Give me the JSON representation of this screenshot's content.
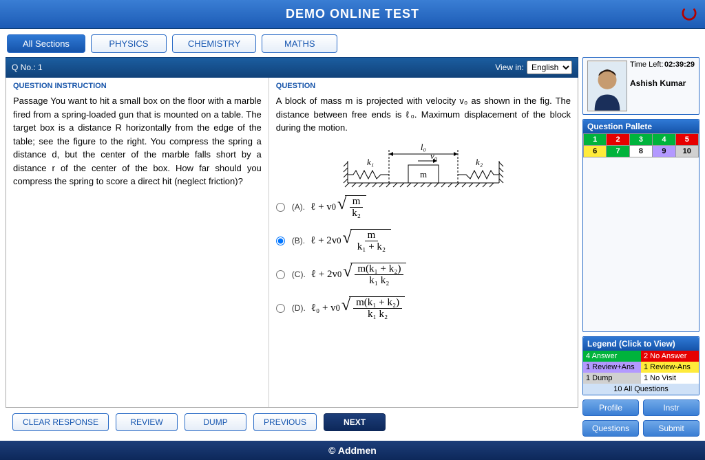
{
  "header": {
    "title": "DEMO ONLINE TEST"
  },
  "tabs": [
    {
      "label": "All Sections",
      "active": true
    },
    {
      "label": "PHYSICS"
    },
    {
      "label": "CHEMISTRY"
    },
    {
      "label": "MATHS"
    }
  ],
  "qbar": {
    "qno": "Q No.: 1",
    "viewin": "View in:",
    "lang": "English"
  },
  "labels": {
    "instruction": "QUESTION INSTRUCTION",
    "question": "QUESTION"
  },
  "passage": "Passage You want to hit a small box on the floor with a marble fired from a spring-loaded gun that is mounted on a table. The target box is a distance R horizontally from the edge of the table; see the figure to the right. You compress the spring a distance d, but the center of the marble falls short by a distance r of the center of the box. How far should you compress the spring to score a direct hit (neglect friction)?",
  "question": "A block of mass m is projected with velocity v₀ as shown in the fig. The distance between free ends is ℓ₀. Maximum displacement of the block during the motion.",
  "options": {
    "A": "(A).",
    "B": "(B).",
    "C": "(C).",
    "D": "(D)."
  },
  "formula": {
    "A": {
      "prefix": "ℓ + v",
      "sub": "0",
      "num": "m",
      "den": "k₂"
    },
    "B": {
      "prefix": "ℓ + 2v",
      "sub": "0",
      "num": "m",
      "den": "k₁ + k₂"
    },
    "C": {
      "prefix": "ℓ + 2v",
      "sub": "0",
      "num": "m(k₁ + k₂)",
      "den": "k₁ k₂"
    },
    "D": {
      "prefix": "ℓ₀ + v",
      "sub": "0",
      "num": "m(k₁ + k₂)",
      "den": "k₁ k₂"
    }
  },
  "diagram": {
    "l0": "l₀",
    "k1": "k₁",
    "k2": "k₂",
    "m": "m",
    "v0": "v₀"
  },
  "buttons": {
    "clear": "CLEAR RESPONSE",
    "review": "REVIEW",
    "dump": "DUMP",
    "prev": "PREVIOUS",
    "next": "NEXT"
  },
  "footer": "© Addmen",
  "user": {
    "timelabel": "Time Left:",
    "time": "02:39:29",
    "name": "Ashish Kumar"
  },
  "palette": {
    "title": "Question Pallete",
    "cells": [
      {
        "n": "1",
        "bg": "#00b33c",
        "fg": "#fff"
      },
      {
        "n": "2",
        "bg": "#e60000",
        "fg": "#fff"
      },
      {
        "n": "3",
        "bg": "#00b33c",
        "fg": "#fff"
      },
      {
        "n": "4",
        "bg": "#00b33c",
        "fg": "#fff"
      },
      {
        "n": "5",
        "bg": "#e60000",
        "fg": "#fff"
      },
      {
        "n": "6",
        "bg": "#ffeb3b",
        "fg": "#000"
      },
      {
        "n": "7",
        "bg": "#00b33c",
        "fg": "#fff"
      },
      {
        "n": "8",
        "bg": "#ffffff",
        "fg": "#000"
      },
      {
        "n": "9",
        "bg": "#b399ff",
        "fg": "#000"
      },
      {
        "n": "10",
        "bg": "#d0d0d0",
        "fg": "#000"
      }
    ]
  },
  "legend": {
    "title": "Legend (Click to View)",
    "items": [
      {
        "t": "4 Answer",
        "bg": "#00b33c",
        "fg": "#fff"
      },
      {
        "t": "2 No Answer",
        "bg": "#e60000",
        "fg": "#fff"
      },
      {
        "t": "1 Review+Ans",
        "bg": "#b399ff",
        "fg": "#000"
      },
      {
        "t": "1 Review-Ans",
        "bg": "#ffeb3b",
        "fg": "#000"
      },
      {
        "t": "1 Dump",
        "bg": "#d0d0d0",
        "fg": "#000"
      },
      {
        "t": "1 No Visit",
        "bg": "#ffffff",
        "fg": "#000"
      }
    ],
    "all": "10 All Questions"
  },
  "sidebtns": {
    "profile": "Profile",
    "instr": "Instr",
    "questions": "Questions",
    "submit": "Submit"
  }
}
